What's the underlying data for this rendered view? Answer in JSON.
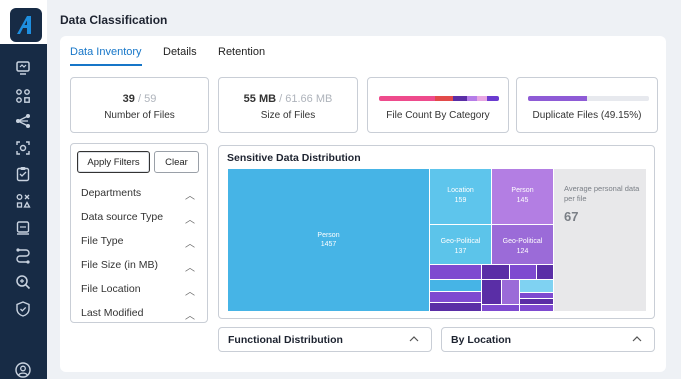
{
  "page": {
    "title": "Data Classification"
  },
  "tabs": [
    {
      "label": "Data Inventory",
      "active": true
    },
    {
      "label": "Details",
      "active": false
    },
    {
      "label": "Retention",
      "active": false
    }
  ],
  "sidebar": {
    "icons": [
      "logo-icon",
      "dashboard-icon",
      "apps-icon",
      "share-network-icon",
      "scan-icon",
      "clipboard-icon",
      "classify-icon",
      "storage-icon",
      "flow-icon",
      "search-icon",
      "shield-icon",
      "user-icon"
    ]
  },
  "stats": {
    "files": {
      "value": "39",
      "total": "/ 59",
      "label": "Number of Files"
    },
    "size": {
      "value": "55 MB",
      "total": "/ 61.66 MB",
      "label": "Size of Files"
    },
    "category": {
      "label": "File Count By Category",
      "bar_colors": [
        "#ee4b8c",
        "#ee4b8c",
        "#ee4b8c",
        "#e24a4a",
        "#5a2ea6",
        "#b57de8",
        "#e8a6e2",
        "#6a3bd0"
      ]
    },
    "duplicates": {
      "label": "Duplicate Files (49.15%)",
      "fraction": 0.4915,
      "bar_color": "#8e5bd6",
      "track_color": "#e7e9ee"
    }
  },
  "filters": {
    "apply_label": "Apply Filters",
    "clear_label": "Clear",
    "items": [
      "Departments",
      "Data source Type",
      "File Type",
      "File Size (in MB)",
      "File Location",
      "Last Modified"
    ]
  },
  "sensitive": {
    "title": "Sensitive Data Distribution",
    "cells": [
      {
        "name": "Person",
        "value": "1457"
      },
      {
        "name": "Location",
        "value": "159"
      },
      {
        "name": "Person",
        "value": "145"
      },
      {
        "name": "Geo-Political",
        "value": "137"
      },
      {
        "name": "Geo-Political",
        "value": "124"
      }
    ],
    "avg_label": "Average personal data per file",
    "avg_value": "67",
    "colors": {
      "person": "#46b4e6",
      "location": "#5ec5ec",
      "person_purple": "#b37ee3",
      "geo_blue": "#5cc4ea",
      "geo_purple": "#9b6bd8",
      "avg": "#e8e8ea",
      "dark_purple": "#5a2ea6",
      "mid_purple": "#7e4ad0",
      "light_blue": "#7fd2f2"
    }
  },
  "dropdowns": {
    "functional": "Functional Distribution",
    "location": "By Location"
  }
}
